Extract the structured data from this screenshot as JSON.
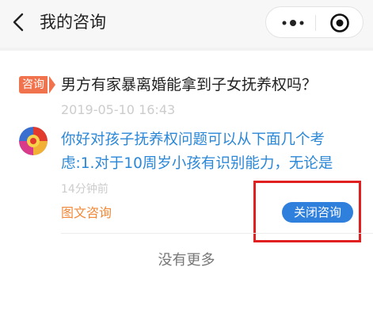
{
  "nav": {
    "title": "我的咨询",
    "back_icon": "chevron-left-icon",
    "more_icon": "more-dots-icon",
    "close_icon": "target-circle-icon"
  },
  "consultation": {
    "tag": "咨询",
    "question": "男方有家暴离婚能拿到子女抚养权吗？",
    "date": "2019-05-10 16:43",
    "avatar_icon": "colorful-avatar-icon",
    "answer": "你好对孩子抚养权问题可以从下面几个考虑:1.对于10周岁小孩有识别能力，无论是",
    "answer_time": "14分钟前",
    "type": "图文咨询",
    "close_label": "关闭咨询"
  },
  "footer": {
    "no_more": "没有更多"
  },
  "colors": {
    "accent_blue": "#2f7fdc",
    "answer_blue": "#2a87d8",
    "tag_orange": "#f1734d",
    "type_orange": "#f08a3a",
    "highlight_red": "#e02020"
  }
}
